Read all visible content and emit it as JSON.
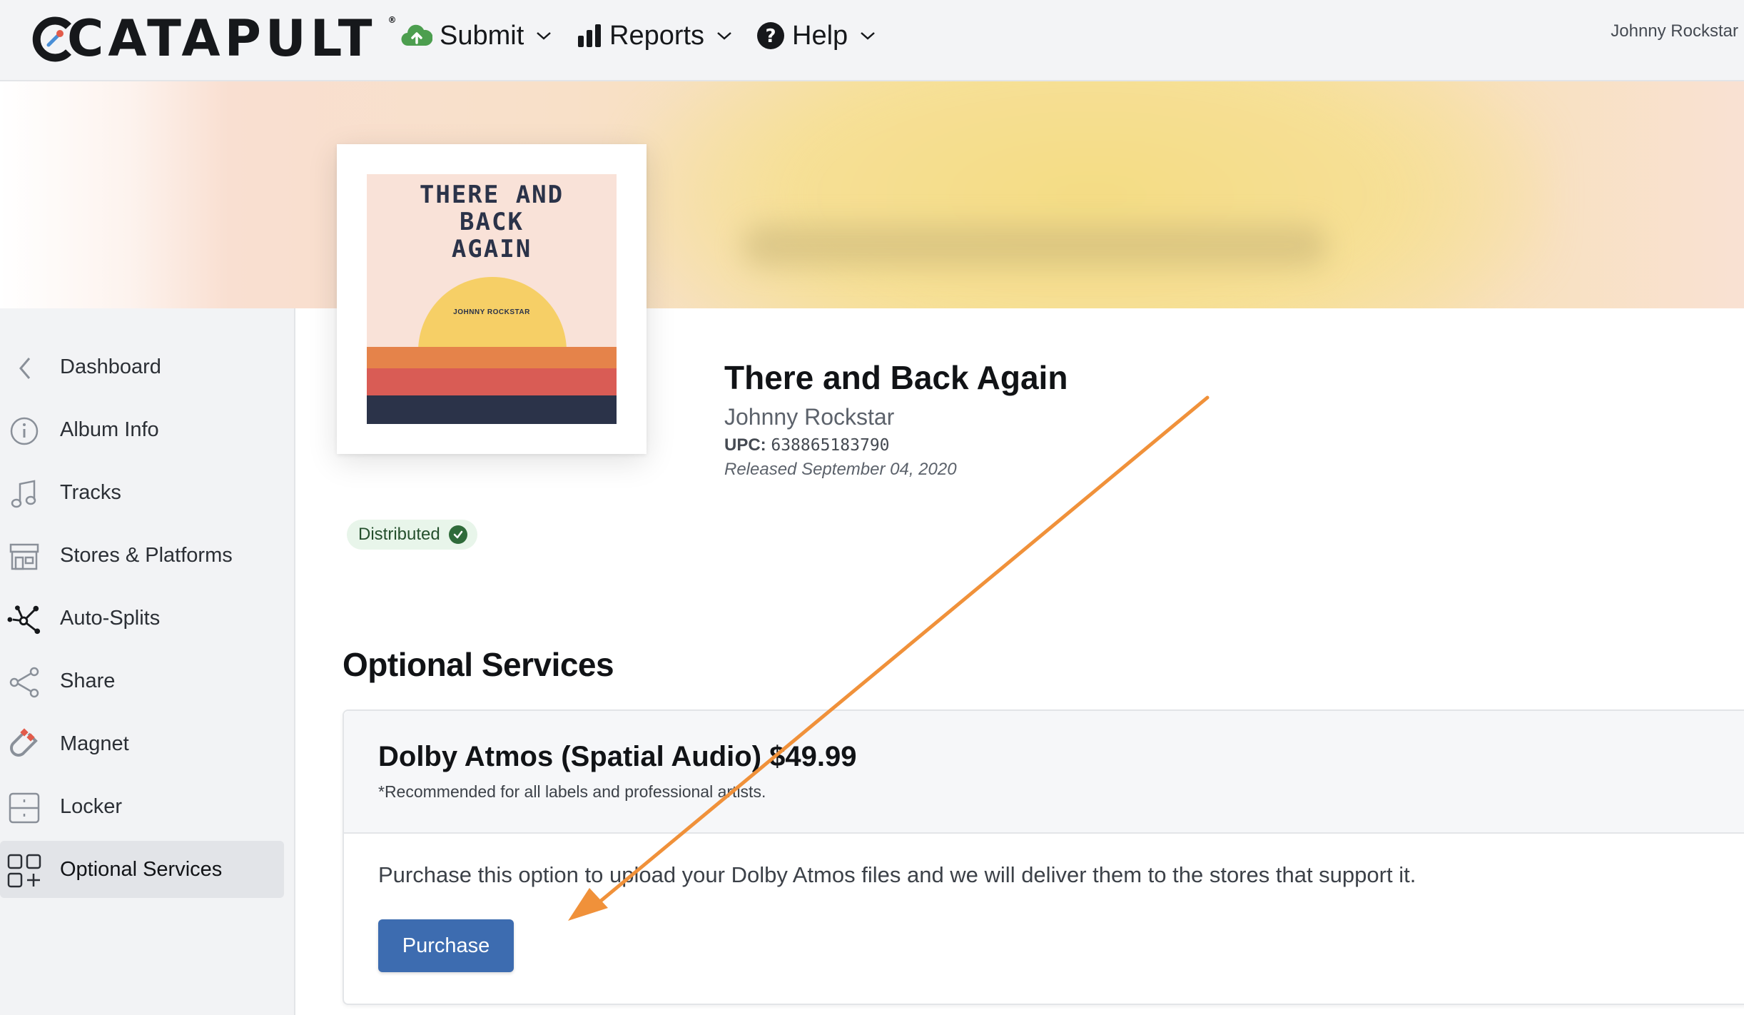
{
  "header": {
    "logo_text": "CATAPULT",
    "logo_mark": "®",
    "nav": [
      {
        "label": "Submit",
        "icon": "cloud-upload-icon"
      },
      {
        "label": "Reports",
        "icon": "bar-chart-icon"
      },
      {
        "label": "Help",
        "icon": "question-circle-icon"
      }
    ],
    "user_name": "Johnny Rockstar"
  },
  "sidebar": {
    "items": [
      {
        "label": "Dashboard",
        "icon": "chevron-left-icon"
      },
      {
        "label": "Album Info",
        "icon": "info-circle-icon"
      },
      {
        "label": "Tracks",
        "icon": "music-note-icon"
      },
      {
        "label": "Stores & Platforms",
        "icon": "storefront-icon"
      },
      {
        "label": "Auto-Splits",
        "icon": "split-network-icon"
      },
      {
        "label": "Share",
        "icon": "share-icon"
      },
      {
        "label": "Magnet",
        "icon": "magnet-icon"
      },
      {
        "label": "Locker",
        "icon": "locker-icon"
      },
      {
        "label": "Optional Services",
        "icon": "grid-plus-icon",
        "active": true
      }
    ]
  },
  "album": {
    "cover": {
      "title_text": "THERE AND\nBACK\nAGAIN",
      "artist_text": "JOHNNY ROCKSTAR"
    },
    "title": "There and Back Again",
    "artist": "Johnny Rockstar",
    "upc_label": "UPC:",
    "upc_value": "638865183790",
    "released": "Released September 04, 2020",
    "status": "Distributed"
  },
  "optional_services": {
    "heading": "Optional Services",
    "service": {
      "name": "Dolby Atmos (Spatial Audio) $49.99",
      "note": "*Recommended for all labels and professional artists.",
      "description": "Purchase this option to upload your Dolby Atmos files and we will deliver them to the stores that support it.",
      "button_label": "Purchase"
    }
  },
  "colors": {
    "primary_button": "#3d6cb0",
    "annotation_arrow": "#f0913a",
    "status_badge_bg": "#e8f5ea",
    "sidebar_bg": "#f2f3f5"
  }
}
